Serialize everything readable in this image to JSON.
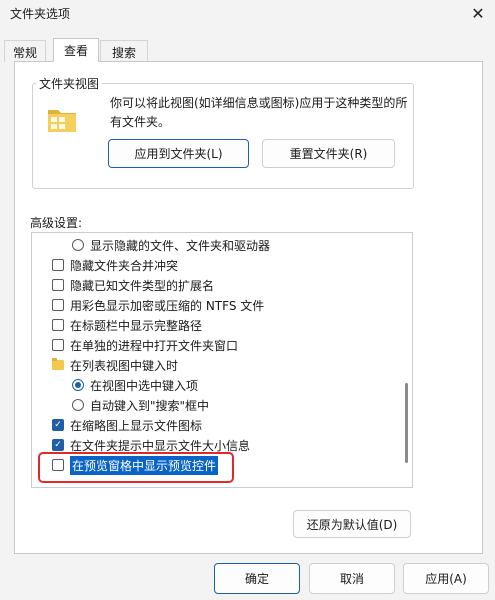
{
  "window": {
    "title": "文件夹选项",
    "close_glyph": "✕"
  },
  "tabs": [
    {
      "label": "常规",
      "active": false
    },
    {
      "label": "查看",
      "active": true
    },
    {
      "label": "搜索",
      "active": false
    }
  ],
  "folder_views": {
    "legend": "文件夹视图",
    "description": "你可以将此视图(如详细信息或图标)应用于这种类型的所有文件夹。",
    "apply_button": "应用到文件夹(L)",
    "reset_button": "重置文件夹(R)"
  },
  "advanced": {
    "label": "高级设置:",
    "items": [
      {
        "type": "radio",
        "checked": false,
        "label": "显示隐藏的文件、文件夹和驱动器"
      },
      {
        "type": "checkbox",
        "checked": false,
        "label": "隐藏文件夹合并冲突"
      },
      {
        "type": "checkbox",
        "checked": false,
        "label": "隐藏已知文件类型的扩展名"
      },
      {
        "type": "checkbox",
        "checked": false,
        "label": "用彩色显示加密或压缩的 NTFS 文件"
      },
      {
        "type": "checkbox",
        "checked": false,
        "label": "在标题栏中显示完整路径"
      },
      {
        "type": "checkbox",
        "checked": false,
        "label": "在单独的进程中打开文件夹窗口"
      },
      {
        "type": "folder",
        "label": "在列表视图中键入时"
      },
      {
        "type": "radio",
        "checked": true,
        "label": "在视图中选中键入项"
      },
      {
        "type": "radio",
        "checked": false,
        "label": "自动键入到\"搜索\"框中"
      },
      {
        "type": "checkbox",
        "checked": true,
        "label": "在缩略图上显示文件图标"
      },
      {
        "type": "checkbox",
        "checked": true,
        "label": "在文件夹提示中显示文件大小信息"
      },
      {
        "type": "checkbox",
        "checked": false,
        "label": "在预览窗格中显示预览控件",
        "selected": true
      }
    ],
    "restore_button": "还原为默认值(D)"
  },
  "footer": {
    "ok": "确定",
    "cancel": "取消",
    "apply": "应用(A)"
  },
  "colors": {
    "accent": "#1f5fa8",
    "selection": "#0a64c8",
    "highlight_box": "#e02a2a",
    "folder": "#f2c94c"
  }
}
